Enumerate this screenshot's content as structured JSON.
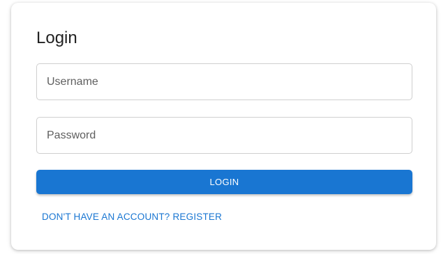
{
  "login_form": {
    "title": "Login",
    "username": {
      "placeholder": "Username",
      "value": ""
    },
    "password": {
      "placeholder": "Password",
      "value": ""
    },
    "login_button_label": "LOGIN",
    "register_link_text": "DON'T HAVE AN ACCOUNT? REGISTER"
  },
  "colors": {
    "primary": "#1976d2",
    "card_background": "#ffffff",
    "field_border": "#cfcfcf",
    "title_text": "#222222"
  }
}
